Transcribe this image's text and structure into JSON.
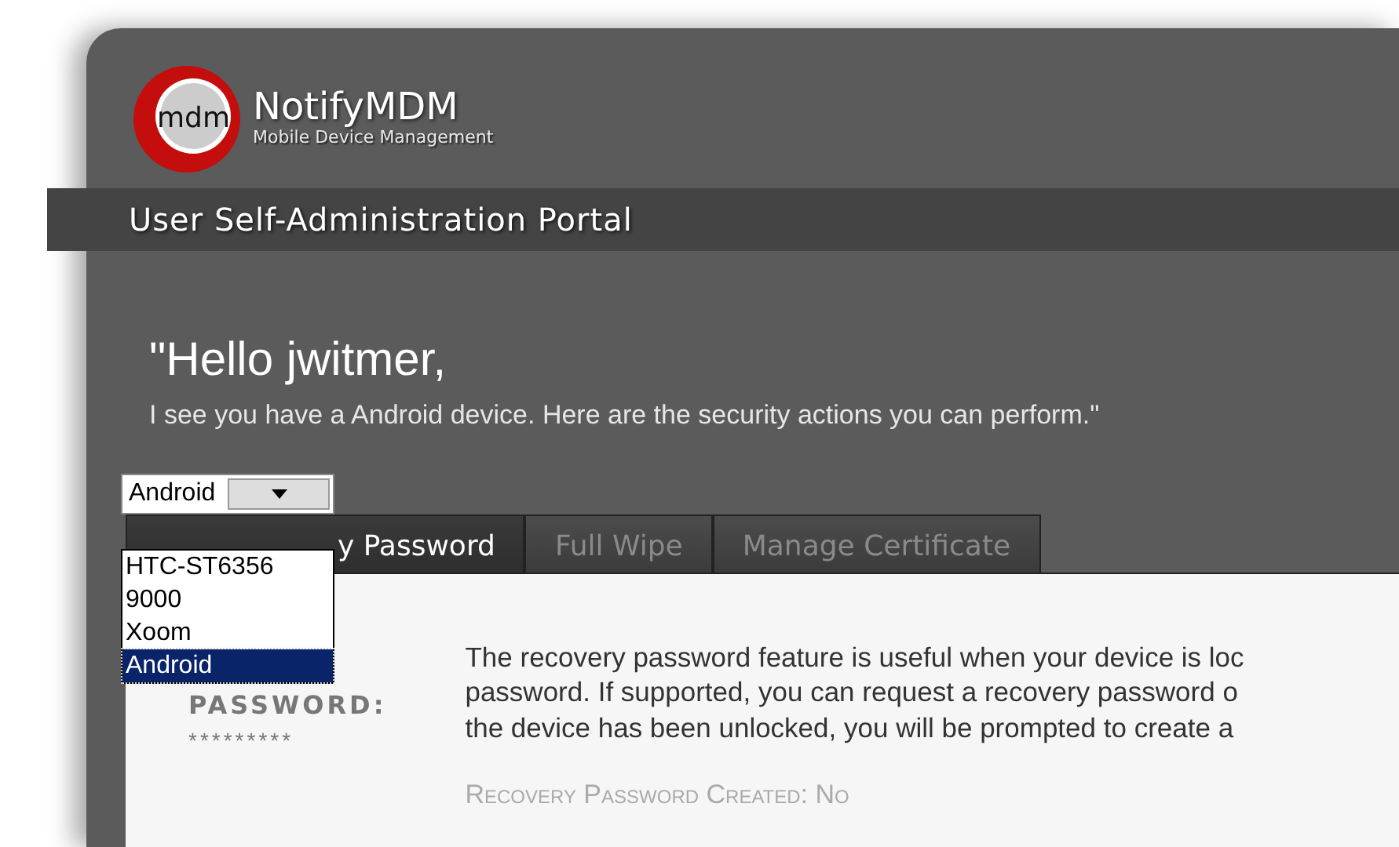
{
  "brand": {
    "logo_text": "mdm",
    "name": "NotifyMDM",
    "tagline": "Mobile Device Management"
  },
  "portal_title": "User Self-Administration Portal",
  "greeting": {
    "headline": "\"Hello jwitmer,",
    "message": "I see you have a Android device. Here are the security actions you can perform.\""
  },
  "device_select": {
    "value": "Android",
    "expanded": true,
    "options": [
      {
        "label": "HTC-ST6356",
        "selected": false
      },
      {
        "label": "9000",
        "selected": false
      },
      {
        "label": "Xoom",
        "selected": false
      },
      {
        "label": "Android",
        "selected": true
      }
    ]
  },
  "tabs": [
    {
      "label": "y Password",
      "selected": true
    },
    {
      "label": "Full Wipe",
      "selected": false
    },
    {
      "label": "Manage Certificate",
      "selected": false
    }
  ],
  "password": {
    "label": "PASSWORD:",
    "value": "*********"
  },
  "description_lines": [
    "The recovery password feature is useful when your device is loc",
    "password. If supported, you can request a recovery password o",
    "the device has been unlocked, you will be prompted to create a"
  ],
  "status": "Recovery Password Created: No"
}
